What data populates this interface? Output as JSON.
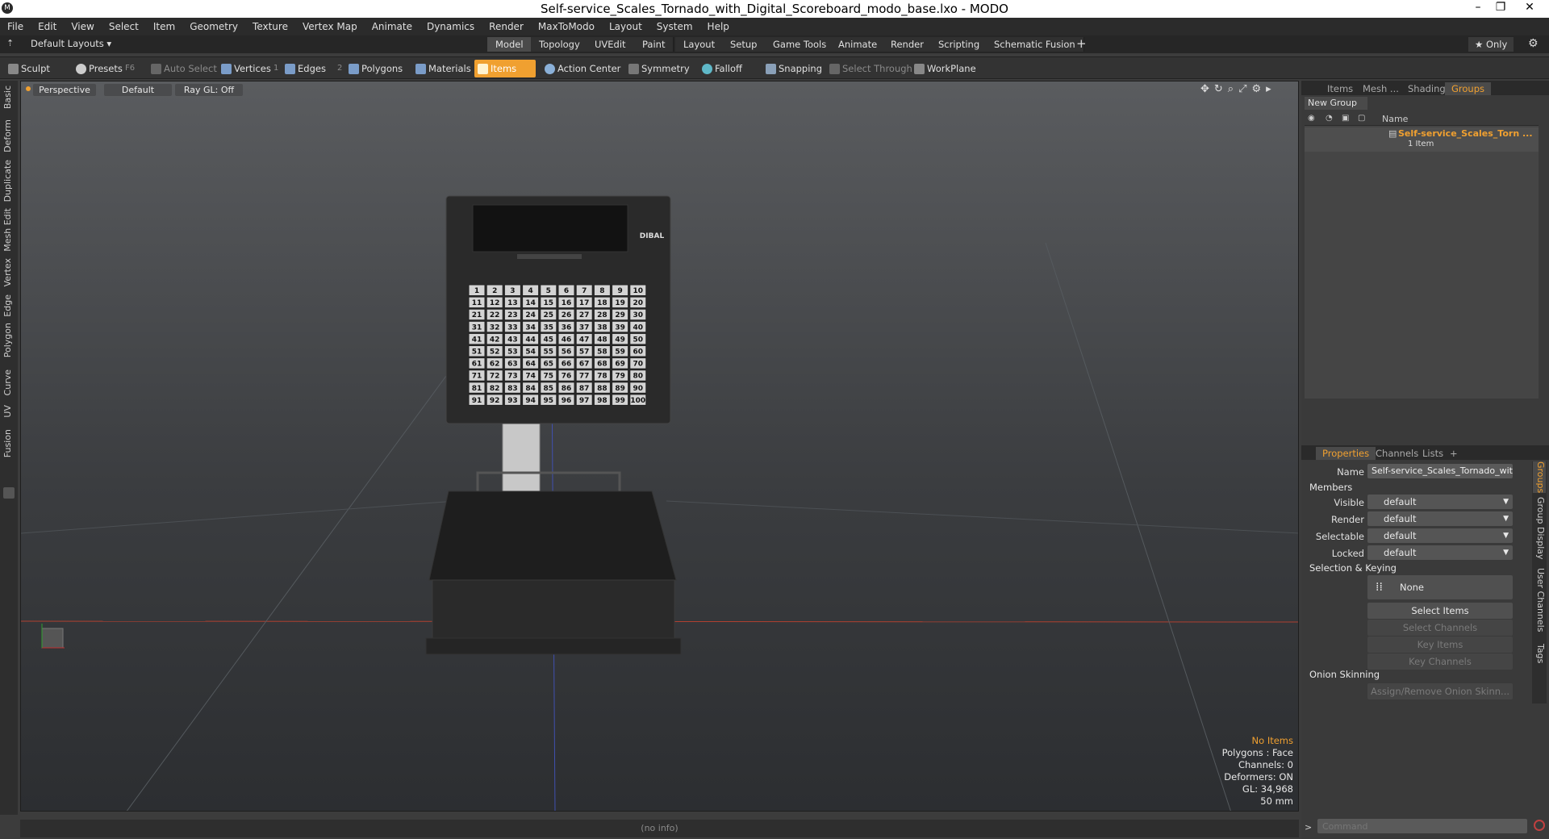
{
  "window": {
    "title": "Self-service_Scales_Tornado_with_Digital_Scoreboard_modo_base.lxo - MODO",
    "logo": "M",
    "controls": [
      "–",
      "❐",
      "✕"
    ]
  },
  "menu": [
    "File",
    "Edit",
    "View",
    "Select",
    "Item",
    "Geometry",
    "Texture",
    "Vertex Map",
    "Animate",
    "Dynamics",
    "Render",
    "MaxToModo",
    "Layout",
    "System",
    "Help"
  ],
  "modebar": {
    "layout_label": "Default Layouts ▾",
    "tabs": [
      "Model",
      "Topology",
      "UVEdit",
      "Paint",
      "Layout",
      "Setup",
      "Game Tools",
      "Animate",
      "Render",
      "Scripting",
      "Schematic Fusion"
    ],
    "active_tab": "Model",
    "add": "+",
    "only_label": "★ Only"
  },
  "toolbar": {
    "sculpt": "Sculpt",
    "presets": "Presets",
    "presets_key": "F6",
    "auto_select": "Auto Select",
    "vertices": "Vertices",
    "vertices_num": "1",
    "edges": "Edges",
    "edges_num": "2",
    "polygons": "Polygons",
    "materials": "Materials",
    "items": "Items",
    "action_center": "Action Center",
    "symmetry": "Symmetry",
    "falloff": "Falloff",
    "snapping": "Snapping",
    "select_through": "Select Through",
    "workplane": "WorkPlane"
  },
  "left_tabs": [
    "Basic",
    "Deform",
    "Duplicate",
    "Mesh Edit",
    "Vertex",
    "Edge",
    "Polygon",
    "Curve",
    "UV",
    "Fusion"
  ],
  "viewport": {
    "view": "Perspective",
    "shading": "Default",
    "raygl": "Ray GL: Off",
    "brand": "DIBAL",
    "key_count": 100,
    "stats": {
      "no_items": "No Items",
      "polygons": "Polygons : Face",
      "channels": "Channels: 0",
      "deformers": "Deformers: ON",
      "gl": "GL: 34,968",
      "size": "50 mm"
    }
  },
  "statusbar": {
    "info": "(no info)"
  },
  "groups_panel": {
    "tabs": [
      "Items",
      "Mesh ...",
      "Shading",
      "Groups"
    ],
    "active_tab": "Groups",
    "new_group": "New Group",
    "col_name": "Name",
    "group_name": "Self-service_Scales_Torn ...",
    "group_count": "1 Item"
  },
  "properties_panel": {
    "tabs": [
      "Properties",
      "Channels",
      "Lists",
      "+"
    ],
    "active_tab": "Properties",
    "name_label": "Name",
    "name_value": "Self-service_Scales_Tornado_with",
    "members": "Members",
    "visible_label": "Visible",
    "visible_value": "default",
    "render_label": "Render",
    "render_value": "default",
    "selectable_label": "Selectable",
    "selectable_value": "default",
    "locked_label": "Locked",
    "locked_value": "default",
    "selection_keying": "Selection & Keying",
    "none": "None",
    "select_items": "Select Items",
    "select_channels": "Select Channels",
    "key_items": "Key Items",
    "key_channels": "Key Channels",
    "onion_skinning": "Onion Skinning",
    "assign_onion": "Assign/Remove Onion Skinn...",
    "side_tabs": [
      "Groups",
      "Group Display",
      "User Channels",
      "Tags"
    ]
  },
  "command": {
    "placeholder": "Command"
  },
  "colors": {
    "accent": "#f0a030",
    "bg": "#3c3c3c"
  }
}
